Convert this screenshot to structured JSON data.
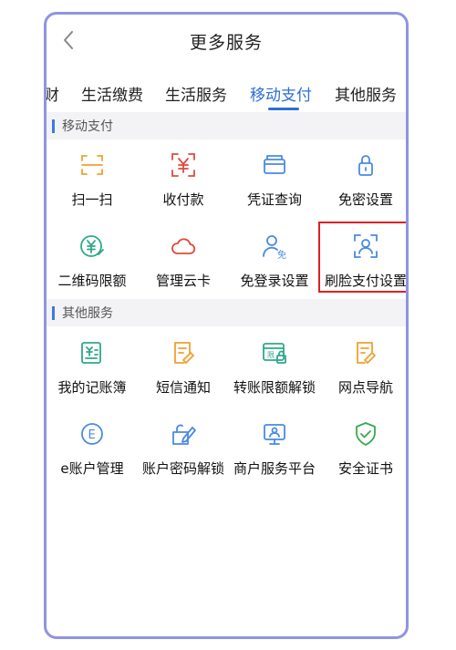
{
  "header": {
    "title": "更多服务",
    "back_icon": "chevron-left-icon"
  },
  "tabs": [
    {
      "label": "财",
      "active": false
    },
    {
      "label": "生活缴费",
      "active": false
    },
    {
      "label": "生活服务",
      "active": false
    },
    {
      "label": "移动支付",
      "active": true
    },
    {
      "label": "其他服务",
      "active": false
    }
  ],
  "sections": [
    {
      "title": "移动支付",
      "items": [
        {
          "label": "扫一扫",
          "icon": "scan-icon"
        },
        {
          "label": "收付款",
          "icon": "yuan-scan-icon"
        },
        {
          "label": "凭证查询",
          "icon": "receipt-icon"
        },
        {
          "label": "免密设置",
          "icon": "lock-icon"
        },
        {
          "label": "二维码限额",
          "icon": "yuan-circle-icon"
        },
        {
          "label": "管理云卡",
          "icon": "cloud-icon"
        },
        {
          "label": "免登录设置",
          "icon": "user-free-icon"
        },
        {
          "label": "刷脸支付设置",
          "icon": "face-scan-icon"
        }
      ]
    },
    {
      "title": "其他服务",
      "items": [
        {
          "label": "我的记账簿",
          "icon": "ledger-icon"
        },
        {
          "label": "短信通知",
          "icon": "sms-icon"
        },
        {
          "label": "转账限额解锁",
          "icon": "limit-unlock-icon"
        },
        {
          "label": "网点导航",
          "icon": "branch-nav-icon"
        },
        {
          "label": "e账户管理",
          "icon": "e-account-icon"
        },
        {
          "label": "账户密码解锁",
          "icon": "password-unlock-icon"
        },
        {
          "label": "商户服务平台",
          "icon": "merchant-icon"
        },
        {
          "label": "安全证书",
          "icon": "shield-check-icon"
        }
      ]
    }
  ],
  "colors": {
    "accent": "#2c6fd6",
    "frame": "#8f95e0",
    "highlight": "#e02020",
    "icon_orange": "#f0a030",
    "icon_red": "#e04a3a",
    "icon_blue": "#4a8ae0",
    "icon_teal": "#2fa88a",
    "icon_green": "#3aa850"
  }
}
